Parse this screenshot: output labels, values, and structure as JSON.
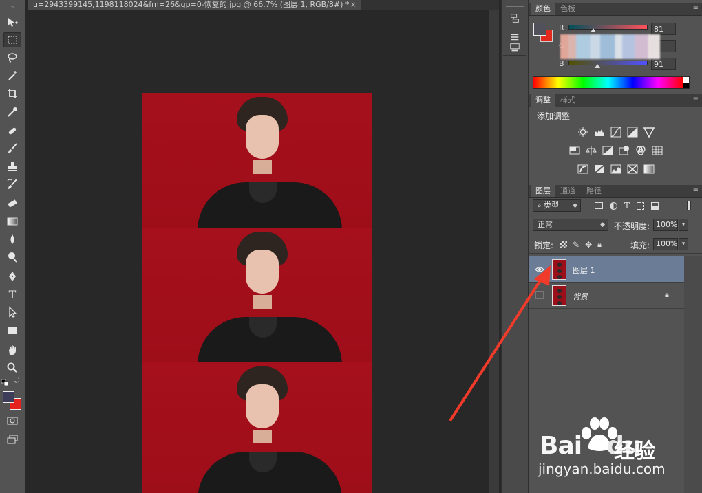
{
  "document": {
    "tab_title": "u=2943399145,1198118024&fm=26&gp=0-恢复的.jpg @ 66.7% (图层 1, RGB/8#) *",
    "close_glyph": "×"
  },
  "toolbar": {
    "tools": [
      "move-icon",
      "marquee-icon",
      "lasso-icon",
      "magic-wand-icon",
      "crop-icon",
      "eyedropper-icon",
      "healing-brush-icon",
      "brush-icon",
      "clone-stamp-icon",
      "history-brush-icon",
      "eraser-icon",
      "gradient-icon",
      "blur-icon",
      "dodge-icon",
      "pen-icon",
      "type-icon",
      "path-selection-icon",
      "rectangle-icon",
      "hand-icon",
      "zoom-icon"
    ],
    "type_tool_glyph": "T",
    "foreground_color": "#3d3d5a",
    "background_color": "#e4231f"
  },
  "color_panel": {
    "tabs": [
      "颜色",
      "色板"
    ],
    "r_label": "R",
    "g_label": "G",
    "b_label": "B",
    "r_value": "81",
    "g_value": "",
    "b_value": "91",
    "foreground_swatch": "#51515b",
    "background_swatch": "#e22a1e"
  },
  "adjustments_panel": {
    "tabs": [
      "调整",
      "样式"
    ],
    "title": "添加调整",
    "row1": [
      "brightness-contrast-icon",
      "levels-icon",
      "curves-icon",
      "exposure-icon",
      "vibrance-icon"
    ],
    "row2": [
      "hue-saturation-icon",
      "color-balance-icon",
      "black-white-icon",
      "photo-filter-icon",
      "channel-mixer-icon",
      "color-lookup-icon"
    ],
    "row3": [
      "invert-icon",
      "posterize-icon",
      "threshold-icon",
      "selective-color-icon",
      "gradient-map-icon"
    ]
  },
  "layers_panel": {
    "tabs": [
      "图层",
      "通道",
      "路径"
    ],
    "filter_label": "类型",
    "blend_mode": "正常",
    "opacity_label": "不透明度:",
    "opacity_value": "100%",
    "lock_label": "锁定:",
    "fill_label": "填充:",
    "fill_value": "100%",
    "layers": [
      {
        "name": "图层 1",
        "selected": true,
        "visible": true
      },
      {
        "name": "背景",
        "selected": false,
        "visible": false,
        "locked": true
      }
    ]
  },
  "watermark": {
    "logo_bai": "Bai",
    "logo_du": "du",
    "logo_cn": "经验",
    "url": "jingyan.baidu.com"
  },
  "colors": {
    "accent_arrow": "#f03a2a",
    "photo_bg": "#a30f1a",
    "selected_layer": "#6b7d96"
  }
}
